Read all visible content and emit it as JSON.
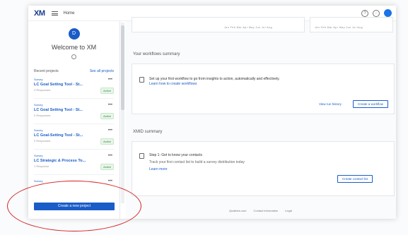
{
  "topbar": {
    "logo": "XM",
    "breadcrumb": "Home",
    "help_icon": "?",
    "notify_icon": "◌"
  },
  "sidebar": {
    "avatar_initial": "D",
    "welcome": "Welcome to XM",
    "recent_label": "Recent projects",
    "see_all": "See all projects",
    "projects": [
      {
        "type": "Survey",
        "name": "LC Goal Setting Tool - St...",
        "meta": "3 Responses",
        "badge": "Active"
      },
      {
        "type": "Survey",
        "name": "LC Goal Setting Tool - St...",
        "meta": "0 Responses",
        "badge": "Active"
      },
      {
        "type": "Survey",
        "name": "LC Goal-Setting Tool - St...",
        "meta": "0 Responses",
        "badge": "Active"
      },
      {
        "type": "Survey",
        "name": "LC Strategic & Process To...",
        "meta": "1 Response",
        "badge": "Active"
      },
      {
        "type": "Survey",
        "name": "",
        "meta": "",
        "badge": ""
      }
    ],
    "create_button": "Create a new project"
  },
  "main": {
    "chart_ticks_left": "Jan  Feb  Mar  Apr  May  Jun  Jul  Aug",
    "chart_ticks_right": "Jan  Feb  Mar  Apr  May  Jun  Jul  Aug",
    "workflows_title": "Your workflows summary",
    "workflows_text": "Set up your first workflow to go from insights to action, automatically and effectively.",
    "workflows_link": "Learn how to create workflows",
    "view_history": "View run history",
    "create_workflow": "Create a workflow",
    "xmid_title": "XMID summary",
    "xmid_step": "Step 1: Get to know your contacts",
    "xmid_text": "Track your first contact list to build a survey distribution today",
    "xmid_link": "Learn more",
    "create_list": "Create contact list"
  },
  "footer": {
    "items": [
      "Qualtrics.com",
      "Contact information",
      "Legal"
    ]
  },
  "colors": {
    "brand": "#1a5cc8",
    "highlight": "#d42020"
  }
}
